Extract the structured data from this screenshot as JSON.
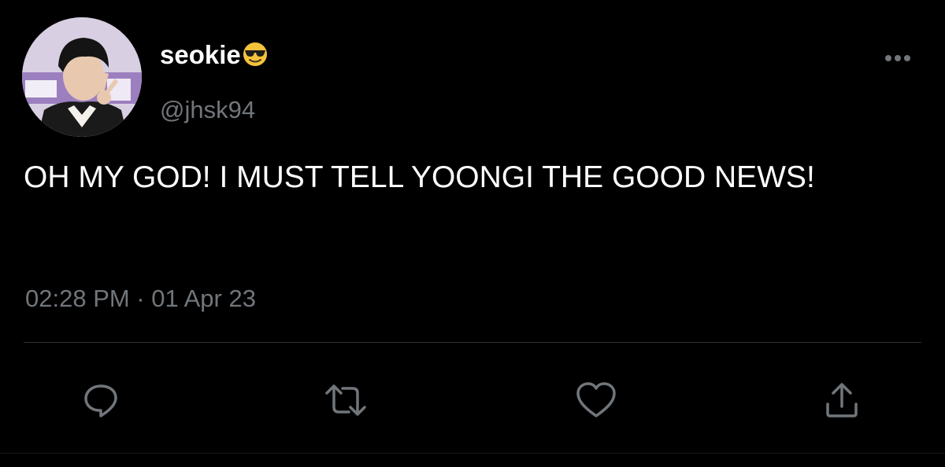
{
  "tweet": {
    "display_name": "seokie",
    "emoji": "smiling-face-with-sunglasses-icon",
    "handle": "@jhsk94",
    "text": "OH MY GOD! I MUST TELL YOONGI THE GOOD NEWS!",
    "timestamp": "02:28 PM · 01 Apr 23"
  },
  "actions": [
    "reply-icon",
    "retweet-icon",
    "like-icon",
    "share-icon"
  ],
  "colors": {
    "background": "#000000",
    "text": "#ffffff",
    "secondary_text": "#71767b",
    "divider": "#2f3336"
  }
}
